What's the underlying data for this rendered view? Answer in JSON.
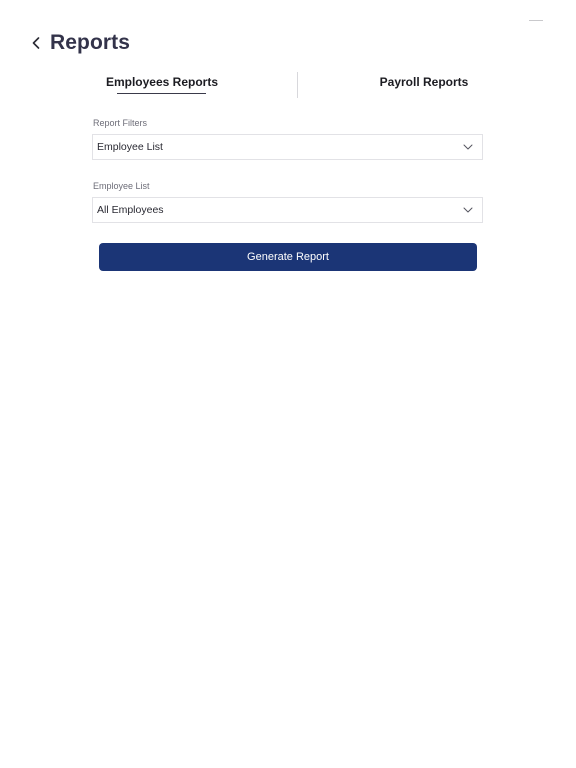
{
  "header": {
    "title": "Reports",
    "back_icon": "chevron-left-icon"
  },
  "tabs": [
    {
      "label": "Employees Reports",
      "active": true
    },
    {
      "label": "Payroll Reports",
      "active": false
    }
  ],
  "filters": {
    "report_filter": {
      "label": "Report Filters",
      "value": "Employee List",
      "icon": "chevron-down-icon"
    },
    "employee_list": {
      "label": "Employee List",
      "value": "All Employees",
      "icon": "chevron-down-icon"
    }
  },
  "actions": {
    "generate_label": "Generate Report"
  },
  "colors": {
    "primary_button": "#1b3576",
    "title": "#33334a",
    "label": "#6d6d78"
  }
}
